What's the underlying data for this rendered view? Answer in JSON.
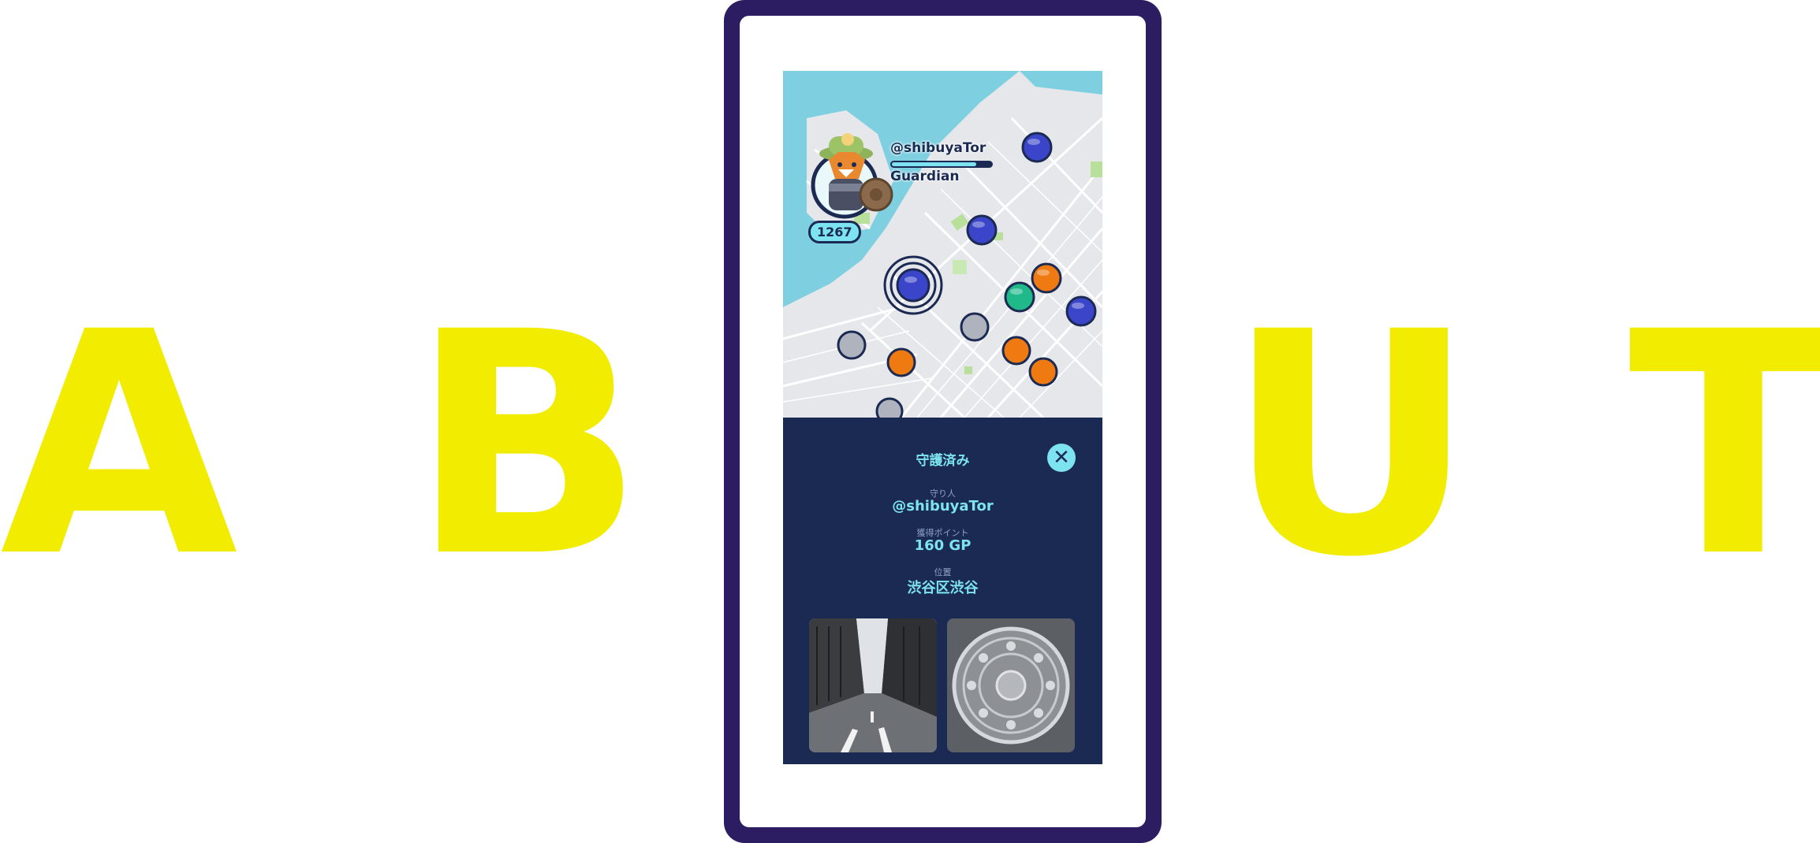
{
  "background_letters": [
    "A",
    "B",
    "U",
    "T"
  ],
  "colors": {
    "accent_yellow": "#f2ec00",
    "phone_frame": "#2c1d62",
    "panel_navy": "#1b2a52",
    "accent_cyan": "#7de3f0",
    "marker_blue": "#3b45c9",
    "marker_orange": "#f07a12",
    "marker_green": "#1fb98a",
    "marker_gray": "#aeb3bd"
  },
  "profile": {
    "username": "@shibuyaTor",
    "role": "Guardian",
    "level": "1267",
    "xp_progress": 0.85,
    "avatar_icon": "fox-character-avatar"
  },
  "sheet": {
    "title": "守護済み",
    "close_icon": "close-icon",
    "guardian_label": "守り人",
    "guardian_value": "@shibuyaTor",
    "points_label": "獲得ポイント",
    "points_value": "160 GP",
    "location_label": "位置",
    "location_value": "渋谷区渋谷",
    "photos": [
      "street-photo",
      "manhole-photo"
    ]
  }
}
